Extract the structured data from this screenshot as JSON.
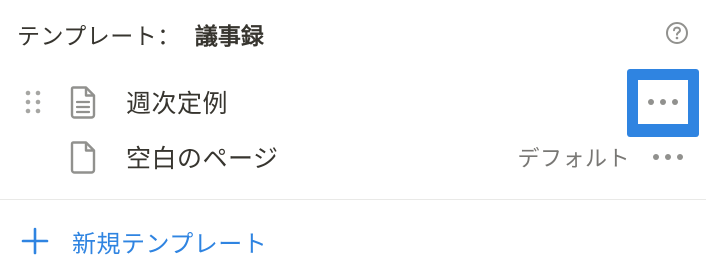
{
  "header": {
    "prefix": "テンプレート：",
    "template_name": "議事録",
    "help_icon": "question-circle-icon"
  },
  "templates": [
    {
      "label": "週次定例",
      "icon": "document-lines-icon",
      "has_drag_handle": true,
      "is_default": false,
      "menu_icon": "ellipsis-icon",
      "menu_highlighted": true
    },
    {
      "label": "空白のページ",
      "icon": "document-blank-icon",
      "has_drag_handle": false,
      "badge": "デフォルト",
      "is_default": true,
      "menu_icon": "ellipsis-icon"
    }
  ],
  "footer": {
    "new_template_label": "新規テンプレート",
    "icon": "plus-icon"
  },
  "colors": {
    "text": "#37352f",
    "muted": "#787774",
    "accent": "#2f84e1",
    "icon": "#91918e",
    "divider": "#e9e9e7"
  }
}
